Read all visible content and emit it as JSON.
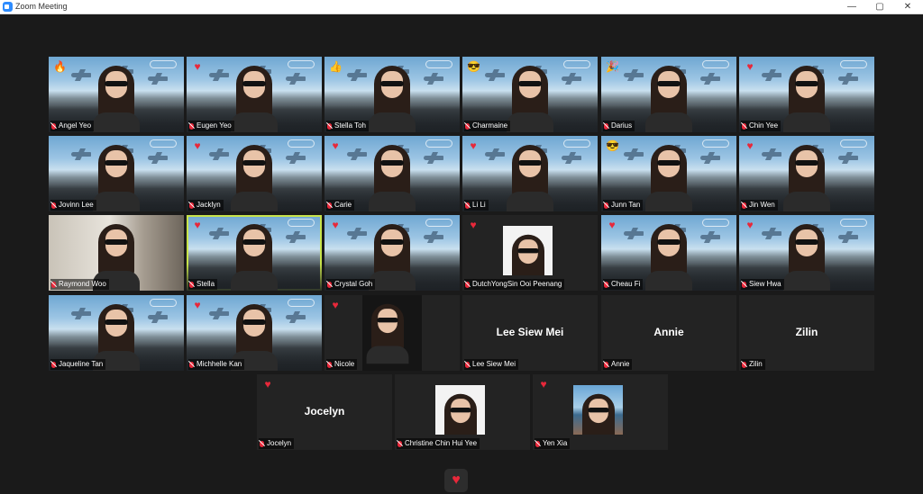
{
  "window": {
    "title": "Zoom Meeting",
    "minimize": "—",
    "maximize": "▢",
    "close": "✕"
  },
  "participants": [
    {
      "name": "Angel Yeo",
      "reaction": "fire-icon",
      "glyph": "🔥",
      "kind": "photo"
    },
    {
      "name": "Eugen Yeo",
      "reaction": "heart-icon",
      "glyph": "♥",
      "kind": "photo"
    },
    {
      "name": "Stella Toh",
      "reaction": "thumbs-up-icon",
      "glyph": "👍",
      "kind": "photo"
    },
    {
      "name": "Charmaine",
      "reaction": "sunglasses-face-icon",
      "glyph": "😎",
      "kind": "photo"
    },
    {
      "name": "Darius",
      "reaction": "party-icon",
      "glyph": "🎉",
      "kind": "photo"
    },
    {
      "name": "Chin Yee",
      "reaction": "heart-icon",
      "glyph": "♥",
      "kind": "photo"
    },
    {
      "name": "Jovinn Lee",
      "reaction": "",
      "glyph": "",
      "kind": "photo"
    },
    {
      "name": "Jacklyn",
      "reaction": "heart-icon",
      "glyph": "♥",
      "kind": "photo"
    },
    {
      "name": "Carie",
      "reaction": "heart-icon",
      "glyph": "♥",
      "kind": "photo"
    },
    {
      "name": "Li Li",
      "reaction": "heart-icon",
      "glyph": "♥",
      "kind": "photo"
    },
    {
      "name": "Junn Tan",
      "reaction": "sunglasses-face-icon",
      "glyph": "😎",
      "kind": "photo"
    },
    {
      "name": "Jin Wen",
      "reaction": "heart-icon",
      "glyph": "♥",
      "kind": "photo"
    },
    {
      "name": "Raymond Woo",
      "reaction": "",
      "glyph": "",
      "kind": "room"
    },
    {
      "name": "Stella",
      "reaction": "heart-icon",
      "glyph": "♥",
      "kind": "photo",
      "active": true
    },
    {
      "name": "Crystal Goh",
      "reaction": "heart-icon",
      "glyph": "♥",
      "kind": "photo"
    },
    {
      "name": "DutchYongSin Ooi Peenang",
      "reaction": "heart-icon",
      "glyph": "♥",
      "kind": "thumb"
    },
    {
      "name": "Cheau Fi",
      "reaction": "heart-icon",
      "glyph": "♥",
      "kind": "photo"
    },
    {
      "name": "Siew Hwa",
      "reaction": "heart-icon",
      "glyph": "♥",
      "kind": "photo"
    },
    {
      "name": "Jaqueline Tan",
      "reaction": "",
      "glyph": "",
      "kind": "photo"
    },
    {
      "name": "Michhelle Kan",
      "reaction": "heart-icon",
      "glyph": "♥",
      "kind": "photo"
    },
    {
      "name": "Nicole",
      "reaction": "heart-icon",
      "glyph": "♥",
      "kind": "dimvideo"
    },
    {
      "name": "Lee Siew Mei",
      "reaction": "",
      "glyph": "",
      "kind": "nametile"
    },
    {
      "name": "Annie",
      "reaction": "",
      "glyph": "",
      "kind": "nametile"
    },
    {
      "name": "Zilin",
      "reaction": "",
      "glyph": "",
      "kind": "nametile"
    },
    {
      "name": "Jocelyn",
      "reaction": "heart-icon",
      "glyph": "♥",
      "kind": "nametile"
    },
    {
      "name": "Christine Chin Hui Yee",
      "reaction": "",
      "glyph": "",
      "kind": "thumb"
    },
    {
      "name": "Yen Xia",
      "reaction": "heart-icon",
      "glyph": "♥",
      "kind": "thumbsea"
    }
  ],
  "bottom_bar": {
    "reaction_glyph": "♥",
    "reaction_icon": "heart-icon"
  }
}
